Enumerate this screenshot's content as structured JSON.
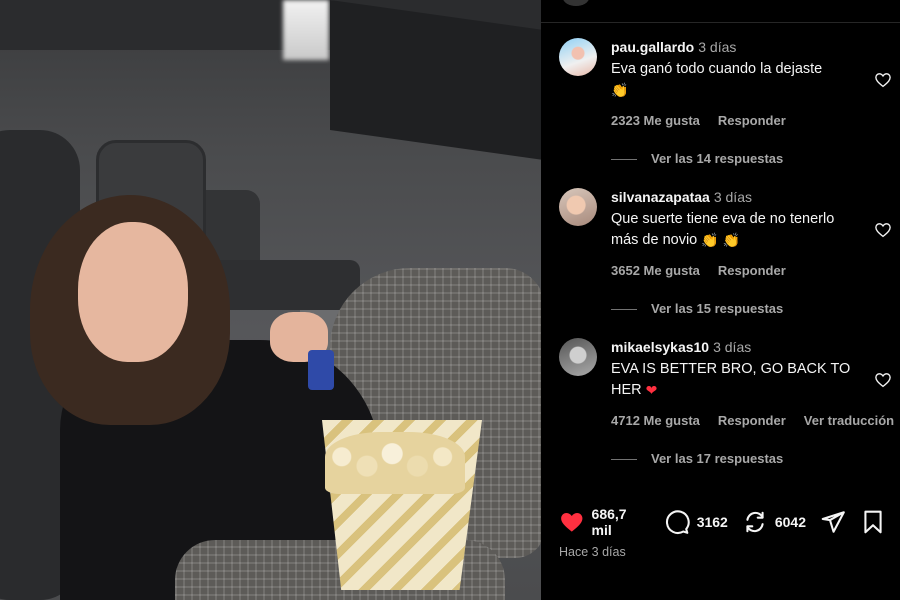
{
  "comments": [
    {
      "user": "pau.gallardo",
      "time": "3 días",
      "text": "Eva ganó todo cuando la dejaste",
      "emoji": "👏",
      "likes": "2323 Me gusta",
      "reply": "Responder",
      "translate": "",
      "view_replies": "Ver las 14 respuestas"
    },
    {
      "user": "silvanazapataa",
      "time": "3 días",
      "text": "Que suerte tiene eva de no tenerlo más de novio",
      "emoji": "👏 👏",
      "likes": "3652 Me gusta",
      "reply": "Responder",
      "translate": "",
      "view_replies": "Ver las 15 respuestas"
    },
    {
      "user": "mikaelsykas10",
      "time": "3 días",
      "text": "EVA IS BETTER BRO, GO BACK TO HER",
      "emoji": "❤",
      "likes": "4712 Me gusta",
      "reply": "Responder",
      "translate": "Ver traducción",
      "view_replies": "Ver las 17 respuestas"
    }
  ],
  "actions": {
    "likes_count": "686,7 mil",
    "comments_count": "3162",
    "reposts_count": "6042"
  },
  "posted_ago": "Hace 3 días",
  "colors": {
    "like_red": "#ff3040",
    "background": "#000000",
    "secondary_text": "#a8a8a8"
  }
}
